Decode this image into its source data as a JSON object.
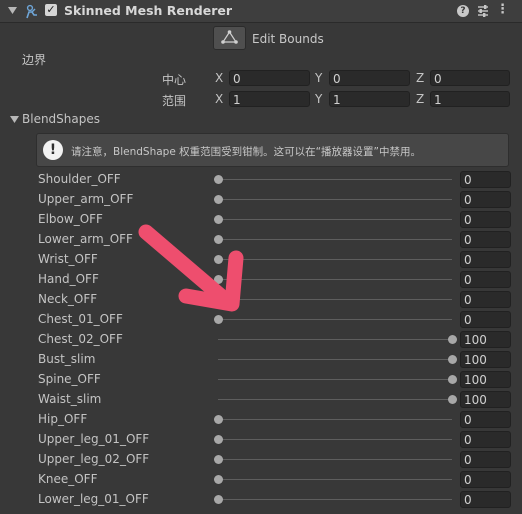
{
  "component": {
    "title": "Skinned Mesh Renderer",
    "enabled": true,
    "help_icon": "help-icon",
    "settings_icon": "preset-sliders-icon",
    "menu_icon": "kebab-menu-icon"
  },
  "edit_bounds": {
    "label": "Edit Bounds",
    "icon": "edit-bounds-icon"
  },
  "bounds": {
    "heading": "边界",
    "center": {
      "label": "中心",
      "x_label": "X",
      "y_label": "Y",
      "z_label": "Z",
      "x": "0",
      "y": "0",
      "z": "0"
    },
    "extent": {
      "label": "范围",
      "x_label": "X",
      "y_label": "Y",
      "z_label": "Z",
      "x": "1",
      "y": "1",
      "z": "1"
    }
  },
  "blendshapes": {
    "title": "BlendShapes",
    "notice": "请注意，BlendShape 权重范围受到钳制。这可以在“播放器设置”中禁用。",
    "items": [
      {
        "name": "Shoulder_OFF",
        "value": "0"
      },
      {
        "name": "Upper_arm_OFF",
        "value": "0"
      },
      {
        "name": "Elbow_OFF",
        "value": "0"
      },
      {
        "name": "Lower_arm_OFF",
        "value": "0"
      },
      {
        "name": "Wrist_OFF",
        "value": "0"
      },
      {
        "name": "Hand_OFF",
        "value": "0"
      },
      {
        "name": "Neck_OFF",
        "value": "0"
      },
      {
        "name": "Chest_01_OFF",
        "value": "0"
      },
      {
        "name": "Chest_02_OFF",
        "value": "100"
      },
      {
        "name": "Bust_slim",
        "value": "100"
      },
      {
        "name": "Spine_OFF",
        "value": "100"
      },
      {
        "name": "Waist_slim",
        "value": "100"
      },
      {
        "name": "Hip_OFF",
        "value": "0"
      },
      {
        "name": "Upper_leg_01_OFF",
        "value": "0"
      },
      {
        "name": "Upper_leg_02_OFF",
        "value": "0"
      },
      {
        "name": "Knee_OFF",
        "value": "0"
      },
      {
        "name": "Lower_leg_01_OFF",
        "value": "0"
      }
    ]
  },
  "annotation": {
    "color": "#ee4e6e"
  }
}
